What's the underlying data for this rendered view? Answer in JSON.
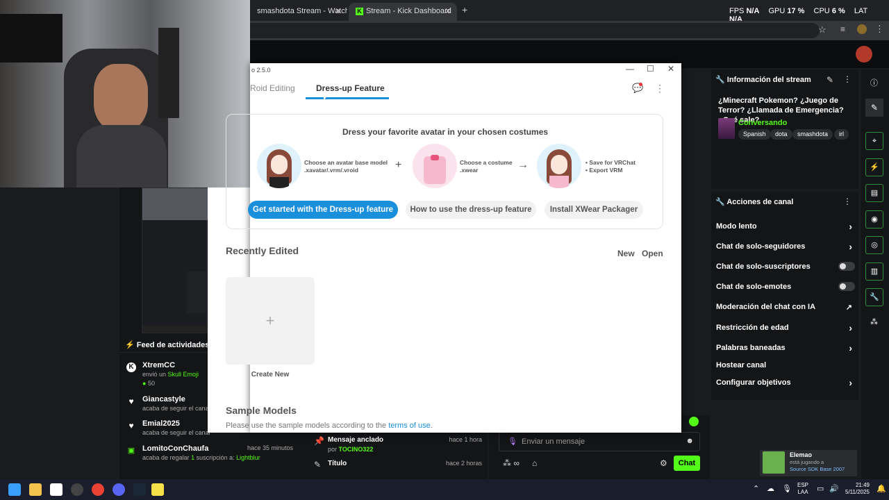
{
  "browser": {
    "tabs": [
      {
        "label": "smashdota Stream - Watch Live"
      },
      {
        "label": "Stream - Kick Dashboard"
      }
    ],
    "new_tab": "+"
  },
  "perf": {
    "fps_label": "FPS",
    "fps": "N/A",
    "gpu_label": "GPU",
    "gpu": "17 %",
    "cpu_label": "CPU",
    "cpu": "6 %",
    "lat_label": "LAT",
    "lat": "N/A"
  },
  "modal": {
    "title": "o 2.5.0",
    "tabs": {
      "roid": "Roid Editing",
      "dress": "Dress-up Feature"
    },
    "card_title": "Dress your favorite avatar in your chosen costumes",
    "step1": {
      "line1": "Choose an avatar base model",
      "line2": ".xavatar/.vrm/.vroid"
    },
    "step2": {
      "line1": "Choose a costume",
      "line2": ".xwear"
    },
    "step3": {
      "line1": "• Save for VRChat",
      "line2": "• Export VRM"
    },
    "plus": "+",
    "arrow": "→",
    "btn_get_started": "Get started with the Dress-up feature",
    "btn_how": "How to use the dress-up feature",
    "btn_install": "Install XWear Packager",
    "recently_edited": "Recently Edited",
    "new": "New",
    "open": "Open",
    "create_plus": "+",
    "create_new": "Create New",
    "sample_models": "Sample Models",
    "sample_desc": "Please use the sample models according to the ",
    "sample_link": "terms of use",
    "sample_end": "."
  },
  "feed": {
    "title": "Feed de actividades",
    "items": [
      {
        "name": "XtremCC",
        "sub1": "envió un ",
        "sub1b": "Skull Emoji",
        "sub2": "50"
      },
      {
        "name": "Giancastyle",
        "sub": "acaba de seguir el canal"
      },
      {
        "name": "Emial2025",
        "sub": "acaba de seguir el canal"
      },
      {
        "name": "LomitoConChaufa",
        "time": "hace 35 minutos",
        "sub": "acaba de regalar ",
        "sub_num": "1",
        "sub_mid": " suscripción a: ",
        "sub_to": "Lightblur"
      }
    ]
  },
  "pinned": {
    "title": "Mensaje anclado",
    "time": "hace 1 hora",
    "by": "por ",
    "author": "TOCINO322",
    "title2": "Título",
    "time2": "hace 2 horas"
  },
  "chat": {
    "placeholder": "Enviar un mensaje",
    "send": "Chat"
  },
  "stream_info": {
    "heading": "Información del stream",
    "title": "¿Minecraft Pokemon? ¿Juego de Terror? ¿Llamada de Emergencia? ¿Qué sale?",
    "category": "Conversando",
    "tags": [
      "Spanish",
      "dota",
      "smashdota",
      "irl"
    ]
  },
  "channel_actions": {
    "heading": "Acciones de canal",
    "items": [
      {
        "label": "Modo lento"
      },
      {
        "label": "Chat de solo-seguidores"
      },
      {
        "label": "Chat de solo-suscriptores"
      },
      {
        "label": "Chat de solo-emotes"
      },
      {
        "label": "Moderación del chat con IA"
      },
      {
        "label": "Restricción de edad"
      },
      {
        "label": "Palabras baneadas"
      },
      {
        "label": "Hostear canal"
      },
      {
        "label": "Configurar objetivos"
      }
    ]
  },
  "notification": {
    "name": "Elemao",
    "sub": "está jugando a",
    "game": "Source SDK Base 2007"
  },
  "taskbar": {
    "lang1": "ESP",
    "lang2": "LAA",
    "time": "21:49",
    "date": "5/11/2025"
  },
  "colors": {
    "kick_green": "#53fc18",
    "vroid_blue": "#1a8fdc"
  }
}
